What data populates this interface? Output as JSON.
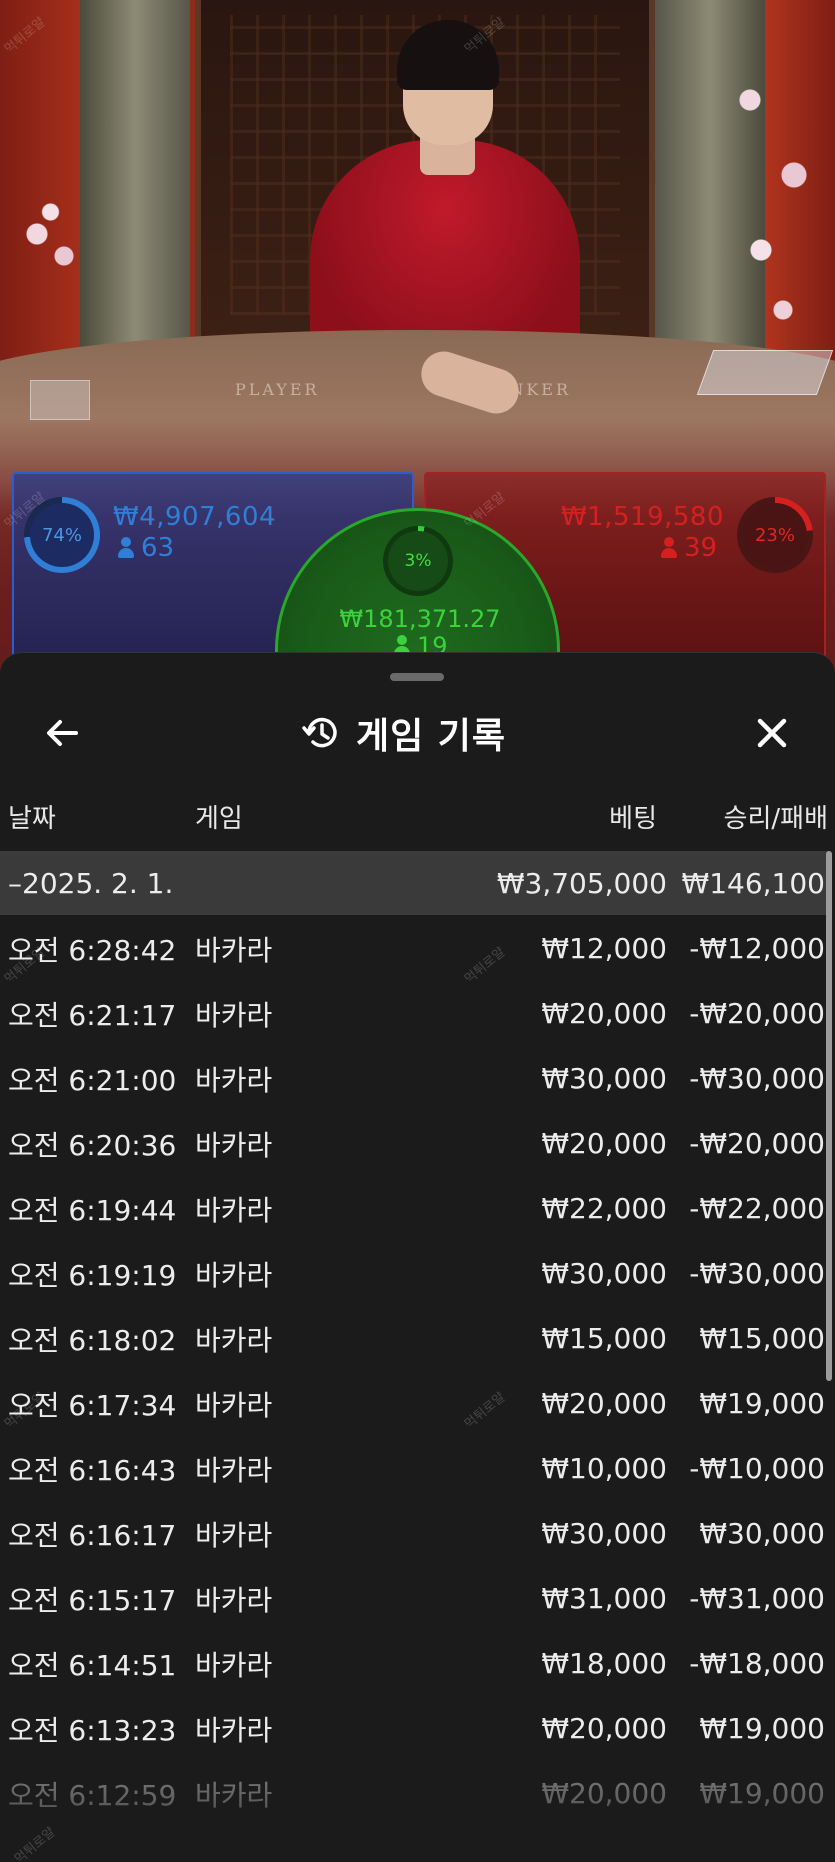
{
  "stats": {
    "player": {
      "percent_label": "74%",
      "percent": 74,
      "amount": "₩4,907,604",
      "count": "63",
      "color": "#2f7fd6"
    },
    "banker": {
      "amount": "₩1,519,580",
      "count": "39",
      "percent_label": "23%",
      "percent": 23,
      "color": "#d52020"
    },
    "tie": {
      "percent_label": "3%",
      "percent": 3,
      "amount": "₩181,371.27",
      "count": "19",
      "color": "#2fcf2f"
    }
  },
  "table_labels": {
    "player": "PLAYER",
    "banker": "BANKER"
  },
  "history": {
    "title": "게임 기록",
    "title_icon": "history-icon",
    "back_icon": "back-arrow-icon",
    "close_icon": "close-icon",
    "columns": {
      "date": "날짜",
      "game": "게임",
      "bet": "베팅",
      "result": "승리/패배"
    },
    "summary": {
      "date": "–2025. 2. 1.",
      "bet": "₩3,705,000",
      "result": "₩146,100"
    },
    "rows": [
      {
        "time": "오전 6:28:42",
        "game": "바카라",
        "bet": "₩12,000",
        "result": "-₩12,000"
      },
      {
        "time": "오전 6:21:17",
        "game": "바카라",
        "bet": "₩20,000",
        "result": "-₩20,000"
      },
      {
        "time": "오전 6:21:00",
        "game": "바카라",
        "bet": "₩30,000",
        "result": "-₩30,000"
      },
      {
        "time": "오전 6:20:36",
        "game": "바카라",
        "bet": "₩20,000",
        "result": "-₩20,000"
      },
      {
        "time": "오전 6:19:44",
        "game": "바카라",
        "bet": "₩22,000",
        "result": "-₩22,000"
      },
      {
        "time": "오전 6:19:19",
        "game": "바카라",
        "bet": "₩30,000",
        "result": "-₩30,000"
      },
      {
        "time": "오전 6:18:02",
        "game": "바카라",
        "bet": "₩15,000",
        "result": "₩15,000"
      },
      {
        "time": "오전 6:17:34",
        "game": "바카라",
        "bet": "₩20,000",
        "result": "₩19,000"
      },
      {
        "time": "오전 6:16:43",
        "game": "바카라",
        "bet": "₩10,000",
        "result": "-₩10,000"
      },
      {
        "time": "오전 6:16:17",
        "game": "바카라",
        "bet": "₩30,000",
        "result": "₩30,000"
      },
      {
        "time": "오전 6:15:17",
        "game": "바카라",
        "bet": "₩31,000",
        "result": "-₩31,000"
      },
      {
        "time": "오전 6:14:51",
        "game": "바카라",
        "bet": "₩18,000",
        "result": "-₩18,000"
      },
      {
        "time": "오전 6:13:23",
        "game": "바카라",
        "bet": "₩20,000",
        "result": "₩19,000"
      },
      {
        "time": "오전 6:12:59",
        "game": "바카라",
        "bet": "₩20,000",
        "result": "₩19,000"
      }
    ]
  },
  "watermark": "먹튀로얄"
}
